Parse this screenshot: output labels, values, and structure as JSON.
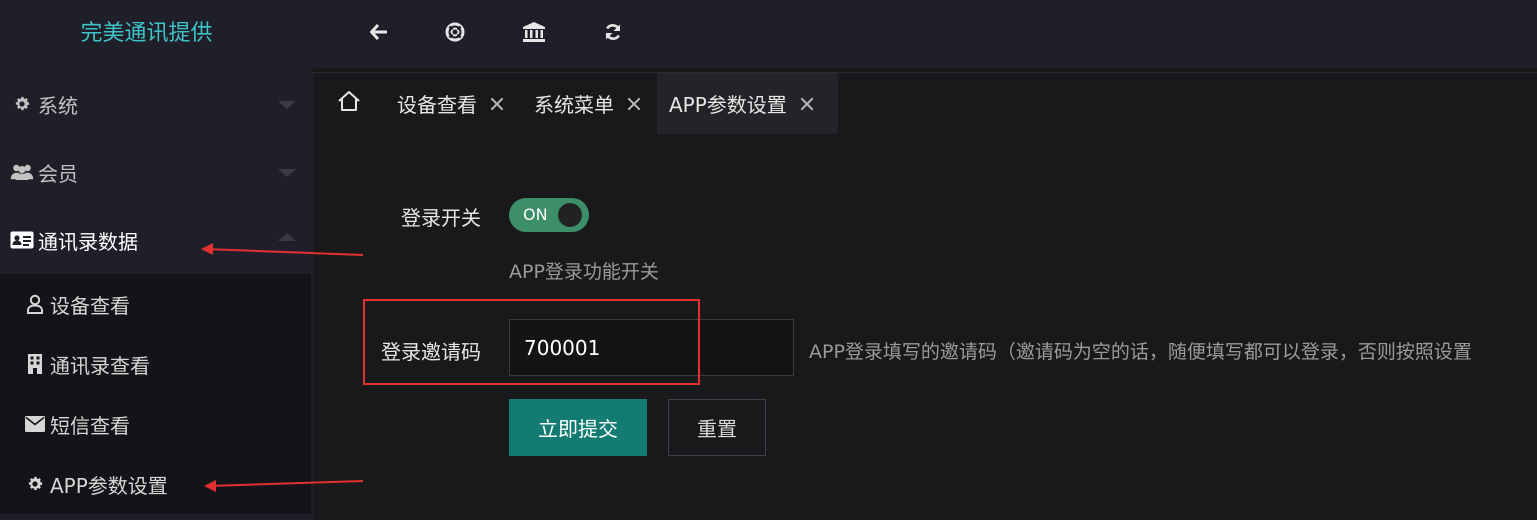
{
  "app": {
    "title": "完美通讯提供"
  },
  "sidebar": {
    "items": [
      {
        "label": "系统",
        "icon": "gear-icon",
        "expanded": false
      },
      {
        "label": "会员",
        "icon": "users-icon",
        "expanded": false
      },
      {
        "label": "通讯录数据",
        "icon": "id-card-icon",
        "expanded": true
      }
    ],
    "submenu": [
      {
        "label": "设备查看",
        "icon": "user-icon"
      },
      {
        "label": "通讯录查看",
        "icon": "building-icon"
      },
      {
        "label": "短信查看",
        "icon": "envelope-icon"
      },
      {
        "label": "APP参数设置",
        "icon": "gear-icon"
      }
    ]
  },
  "toolbar": {
    "icons": [
      "arrow-left-icon",
      "lifebuoy-icon",
      "bank-icon",
      "refresh-icon"
    ]
  },
  "tabs": [
    {
      "label": "设备查看",
      "active": false
    },
    {
      "label": "系统菜单",
      "active": false
    },
    {
      "label": "APP参数设置",
      "active": true
    }
  ],
  "form": {
    "login_switch": {
      "label": "登录开关",
      "state_text": "ON",
      "enabled": true,
      "hint": "APP登录功能开关"
    },
    "invite_code": {
      "label": "登录邀请码",
      "value": "700001",
      "hint": "APP登录填写的邀请码（邀请码为空的话，随便填写都可以登录，否则按照设置"
    },
    "submit_label": "立即提交",
    "reset_label": "重置"
  },
  "colors": {
    "accent": "#127c72",
    "switch_on": "#3d8f6a",
    "logo": "#3ec4c7",
    "annotation": "#e03030"
  }
}
